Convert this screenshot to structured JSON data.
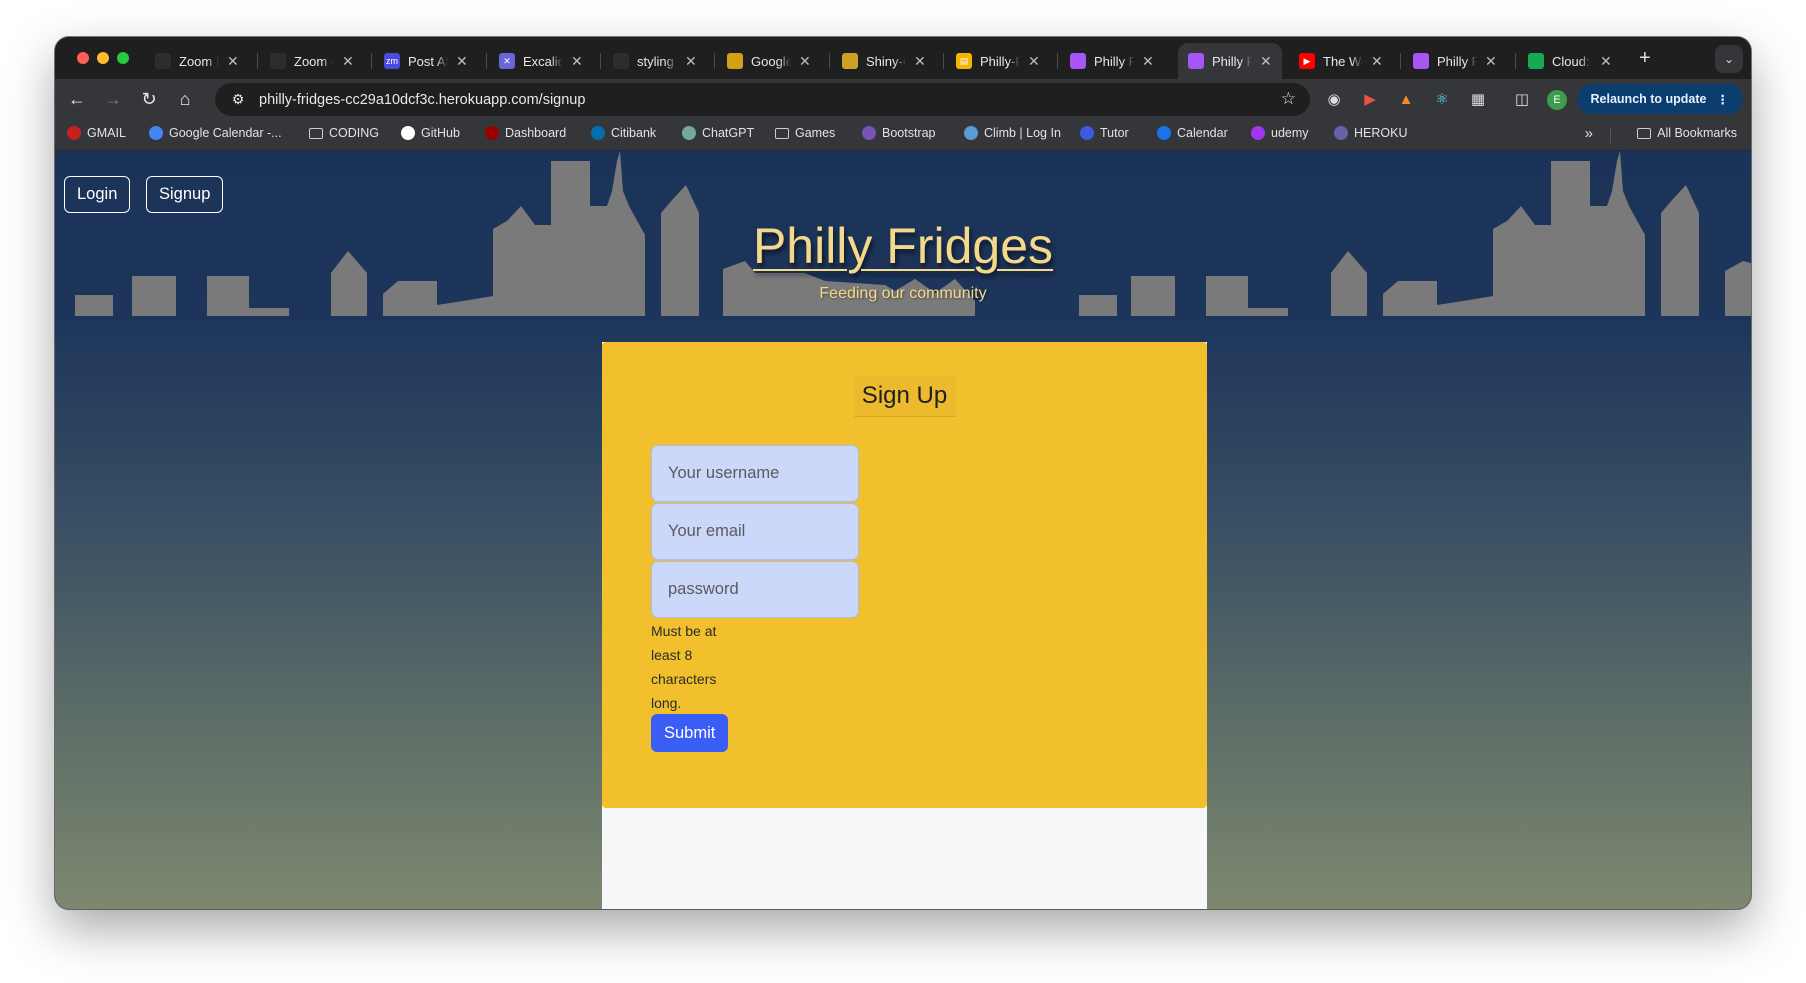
{
  "browser": {
    "tabs": [
      {
        "title": "Zoom I",
        "icon": "zoom-favicon",
        "color": "#2d2d2d"
      },
      {
        "title": "Zoom -",
        "icon": "upenn-shield-favicon",
        "color": "#2d2d2d"
      },
      {
        "title": "Post At",
        "icon": "zm-favicon",
        "color": "#4a4adf"
      },
      {
        "title": "Excalid",
        "icon": "excalidraw-favicon",
        "color": "#6965db"
      },
      {
        "title": "styling",
        "icon": "loading-spinner-favicon",
        "color": "#2d2d2d"
      },
      {
        "title": "Google",
        "icon": "google-drive-favicon",
        "color": "#d4a017"
      },
      {
        "title": "Shiny-C",
        "icon": "shiny-favicon",
        "color": "#c9a227"
      },
      {
        "title": "Philly-F",
        "icon": "slides-favicon",
        "color": "#f4b400"
      },
      {
        "title": "Philly F",
        "icon": "vite-favicon",
        "color": "#a855f7"
      },
      {
        "title": "Philly F",
        "icon": "vite-favicon",
        "color": "#a855f7"
      },
      {
        "title": "The Wo",
        "icon": "youtube-favicon",
        "color": "#ff0000"
      },
      {
        "title": "Philly F",
        "icon": "vite-favicon",
        "color": "#a855f7"
      },
      {
        "title": "Cloud:",
        "icon": "mongodb-leaf-favicon",
        "color": "#13aa52"
      }
    ],
    "active_tab_index": 9,
    "url": "philly-fridges-cc29a10dcf3c.herokuapp.com/signup",
    "profile_initial": "E",
    "relaunch_label": "Relaunch to update",
    "bookmarks": [
      {
        "label": "GMAIL",
        "icon": "gmail-icon",
        "color": "#c5221f"
      },
      {
        "label": "Google Calendar -...",
        "icon": "calendar-icon",
        "color": "#4285f4"
      },
      {
        "label": "CODING",
        "icon": "folder-icon",
        "color": ""
      },
      {
        "label": "GitHub",
        "icon": "github-icon",
        "color": "#ffffff"
      },
      {
        "label": "Dashboard",
        "icon": "upenn-shield-icon",
        "color": "#990000"
      },
      {
        "label": "Citibank",
        "icon": "citi-icon",
        "color": "#056dae"
      },
      {
        "label": "ChatGPT",
        "icon": "chatgpt-icon",
        "color": "#74aa9c"
      },
      {
        "label": "Games",
        "icon": "folder-icon",
        "color": ""
      },
      {
        "label": "Bootstrap",
        "icon": "bootstrap-icon",
        "color": "#7952b3"
      },
      {
        "label": "Climb | Log In",
        "icon": "climb-icon",
        "color": "#5b9bd5"
      },
      {
        "label": "Tutor",
        "icon": "tutor-icon",
        "color": "#3b5bdb"
      },
      {
        "label": "Calendar",
        "icon": "calendar-14-icon",
        "color": "#1a73e8"
      },
      {
        "label": "udemy",
        "icon": "udemy-icon",
        "color": "#a435f0"
      },
      {
        "label": "HEROKU",
        "icon": "heroku-icon",
        "color": "#6762a6"
      }
    ],
    "all_bookmarks_label": "All Bookmarks"
  },
  "page": {
    "nav": {
      "login_label": "Login",
      "signup_label": "Signup"
    },
    "header": {
      "title": "Philly Fridges",
      "subtitle": "Feeding our community"
    },
    "form": {
      "title": "Sign Up",
      "username_placeholder": "Your username",
      "email_placeholder": "Your email",
      "password_placeholder": "password",
      "password_hint": "Must be at least 8 characters long.",
      "submit_label": "Submit"
    },
    "colors": {
      "card": "#f2c02c",
      "title_text": "#f5d98a",
      "submit": "#3a5ef5",
      "input": "#cbd8fa",
      "sky_top": "#1b3358",
      "sky_bottom": "#7d8870",
      "skyline": "#7a7a7a"
    }
  }
}
